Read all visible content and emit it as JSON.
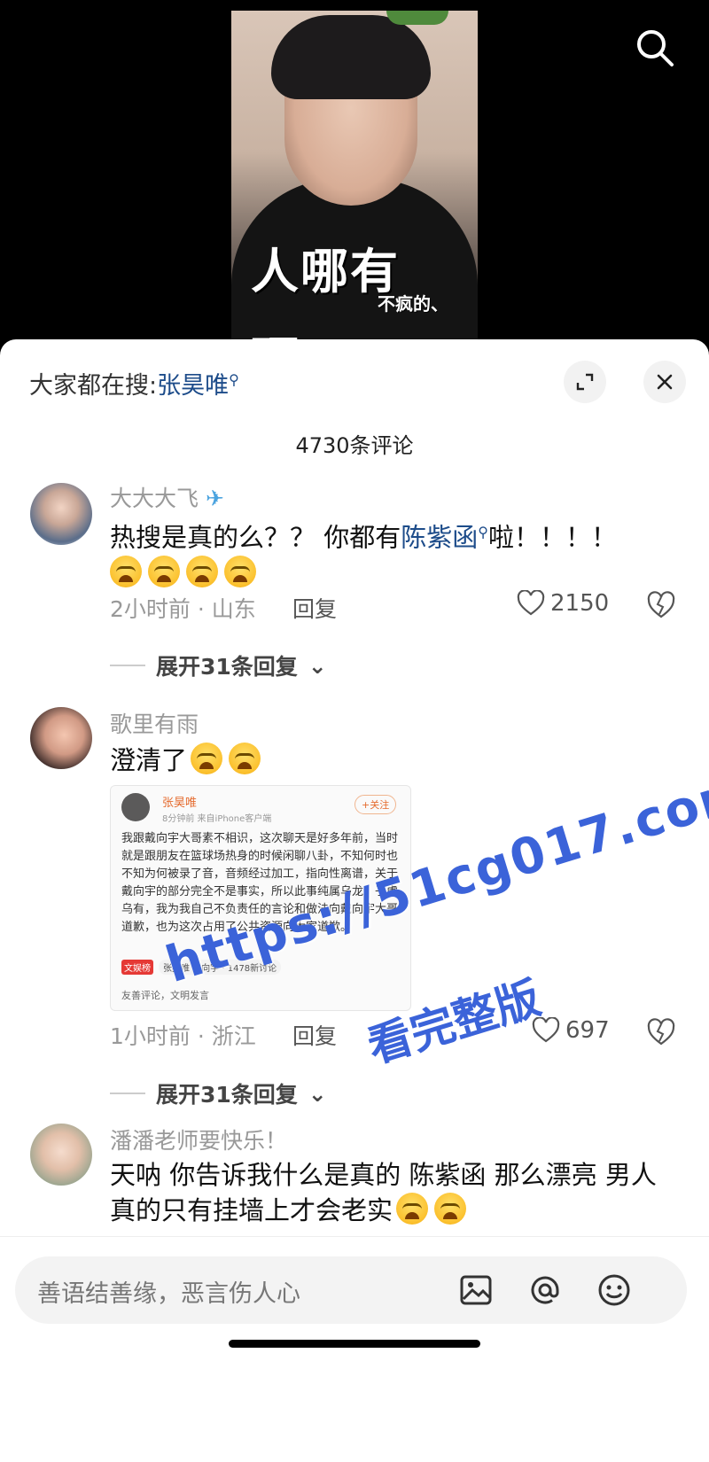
{
  "video": {
    "caption_line1": "人哪有",
    "caption_line2": "不疯的、",
    "caption_line3": "硬"
  },
  "sheet": {
    "hot_search_prefix": "大家都在搜:",
    "hot_search_keyword": "张昊唯",
    "comment_count": "4730条评论"
  },
  "comments": [
    {
      "username": "大大大飞",
      "text_a": "热搜是真的么？？ 你都有",
      "text_keyword": "陈紫函",
      "text_b": "啦！！！！",
      "meta": "2小时前 · 山东",
      "reply_label": "回复",
      "likes": "2150",
      "expand_label": "展开31条回复"
    },
    {
      "username": "歌里有雨",
      "text": "澄清了",
      "meta": "1小时前 · 浙江",
      "reply_label": "回复",
      "likes": "697",
      "expand_label": "展开31条回复",
      "embedded": {
        "name": "张昊唯",
        "time": "8分钟前  来自iPhone客户端",
        "follow": "+关注",
        "body": "我跟戴向宇大哥素不相识，这次聊天是好多年前，当时就是跟朋友在篮球场热身的时候闲聊八卦，不知何时也不知为何被录了音，音频经过加工，指向性离谱，关于戴向宇的部分完全不是事实，所以此事纯属乌龙，子虚乌有，我为我自己不负责任的言论和做法向戴向宇大哥道歉，也为这次占用了公共资源向大家道歉。",
        "tag": "文娱榜",
        "tag_text": "张昊唯 戴向宇 · 1478新讨论",
        "comment_hint": "友善评论，文明发言"
      }
    },
    {
      "username": "潘潘老师要快乐！",
      "text": "天呐 你告诉我什么是真的 陈紫函 那么漂亮 男人真的只有挂墙上才会老实"
    }
  ],
  "watermark": {
    "line1": "https://51cg017.com",
    "line2": "看完整版"
  },
  "input": {
    "placeholder": "善语结善缘，恶言伤人心"
  },
  "icons": {
    "search": "search-icon",
    "expand": "expand-icon",
    "close": "close-icon",
    "heart": "heart-icon",
    "broken_heart": "broken-heart-icon",
    "image": "image-icon",
    "at": "at-icon",
    "emoji": "emoji-icon",
    "chevron": "chevron-down-icon"
  },
  "colors": {
    "link": "#1d4c8a",
    "watermark": "#3b63d9"
  }
}
